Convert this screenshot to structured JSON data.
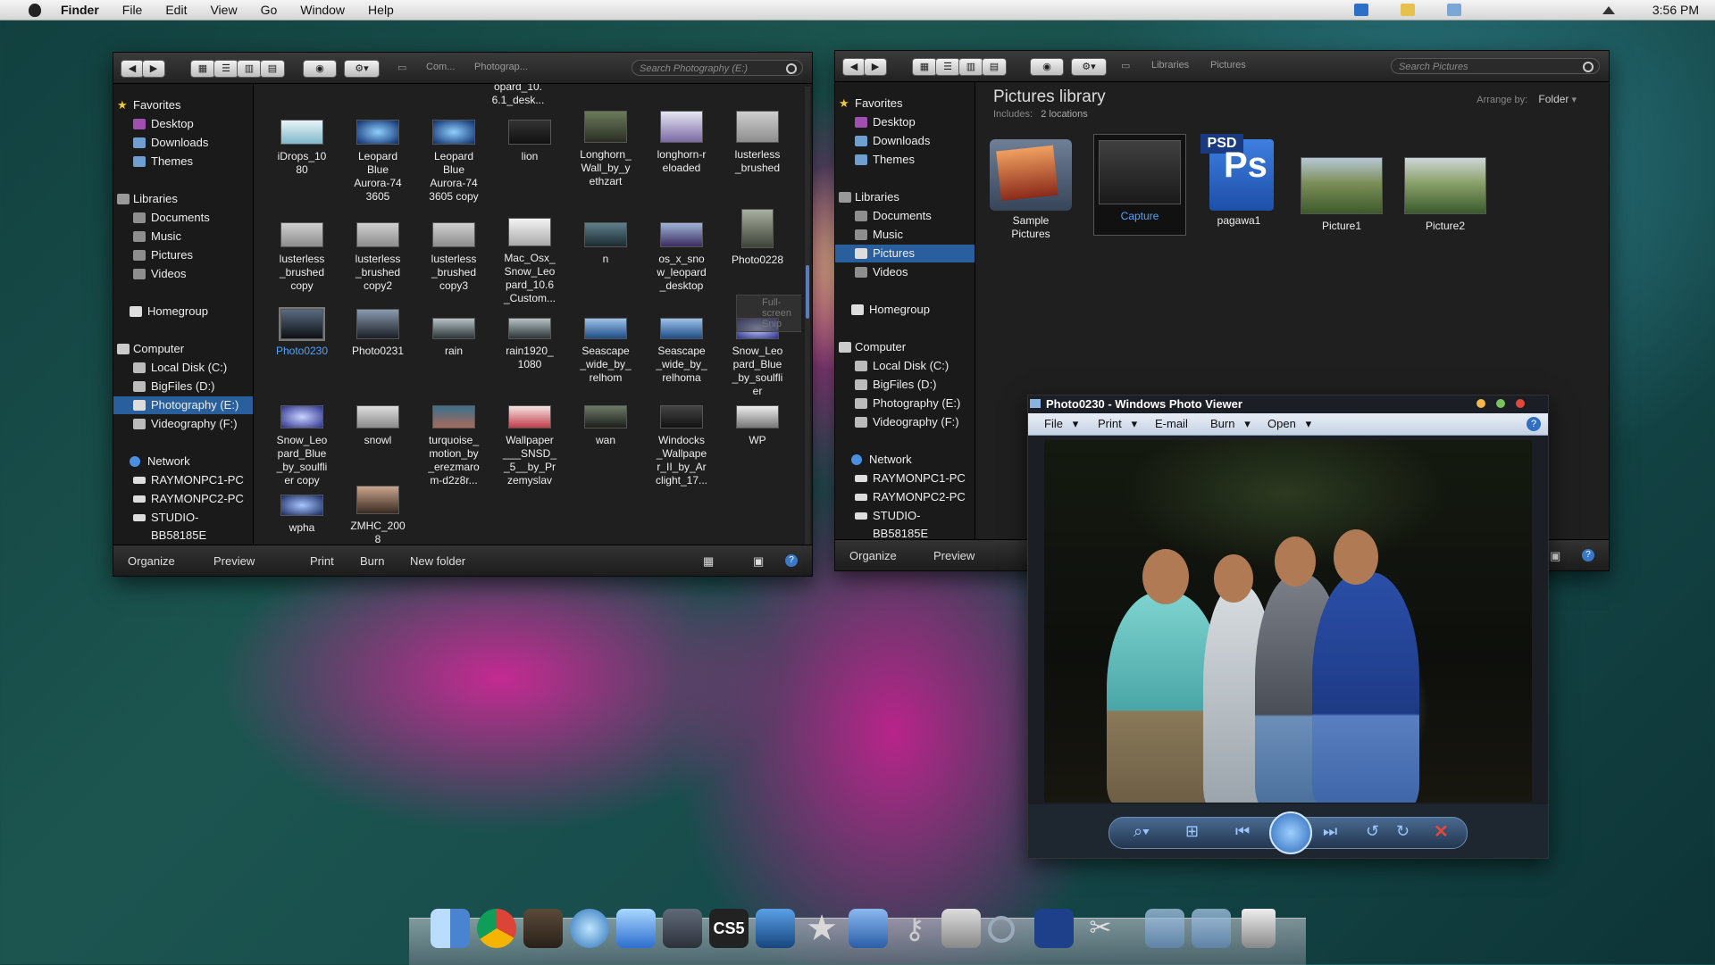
{
  "menubar": {
    "app": "Finder",
    "items": [
      "File",
      "Edit",
      "View",
      "Go",
      "Window",
      "Help"
    ],
    "clock": "3:56 PM"
  },
  "finder1": {
    "breadcrumb": [
      "Com...",
      "Photograp..."
    ],
    "search_placeholder": "Search Photography (E:)",
    "sidebar": {
      "favorites": "Favorites",
      "fav_items": [
        "Desktop",
        "Downloads",
        "Themes"
      ],
      "libraries": "Libraries",
      "lib_items": [
        "Documents",
        "Music",
        "Pictures",
        "Videos"
      ],
      "homegroup": "Homegroup",
      "computer": "Computer",
      "comp_items": [
        "Local Disk (C:)",
        "BigFiles (D:)",
        "Photography (E:)",
        "Videography (F:)"
      ],
      "network": "Network",
      "net_items": [
        "RAYMONPC1-PC",
        "RAYMONPC2-PC",
        "STUDIO-BB58185E"
      ]
    },
    "files": [
      "opard_10.\n6.1_desk...",
      "iDrops_10\n80",
      "Leopard\nBlue\nAurora-74\n3605",
      "Leopard\nBlue\nAurora-74\n3605 copy",
      "lion",
      "Longhorn_\nWall_by_y\nethzart",
      "longhorn-r\neloaded",
      "lusterless\n_brushed",
      "lusterless\n_brushed\ncopy",
      "lusterless\n_brushed\ncopy2",
      "lusterless\n_brushed\ncopy3",
      "Mac_Osx_\nSnow_Leo\npard_10.6\n_Custom...",
      "n",
      "os_x_sno\nw_leopard\n_desktop",
      "Photo0228",
      "Photo0230",
      "Photo0231",
      "rain",
      "rain1920_\n1080",
      "Seascape\n_wide_by_\nrelhom",
      "Seascape\n_wide_by_\nrelhoma",
      "Snow_Leo\npard_Blue\n_by_soulfli\ner",
      "Snow_Leo\npard_Blue\n_by_soulfli\ner copy",
      "snowl",
      "turquoise_\nmotion_by\n_erezmaro\nm-d2z8r...",
      "Wallpaper\n___SNSD_\n_5__by_Pr\nzemyslav",
      "wan",
      "Windocks\n_Wallpape\nr_II_by_Ar\nclight_17...",
      "WP",
      "wpha",
      "ZMHC_200\n8"
    ],
    "tooltip": "Full-screen Snip",
    "bottom": [
      "Organize",
      "Preview",
      "Print",
      "Burn",
      "New folder"
    ]
  },
  "finder2": {
    "breadcrumb": [
      "Libraries",
      "Pictures"
    ],
    "search_placeholder": "Search Pictures",
    "title": "Pictures library",
    "includes_label": "Includes:",
    "includes_value": "2 locations",
    "arrange_label": "Arrange by:",
    "arrange_value": "Folder",
    "items": [
      "Sample\nPictures",
      "Capture",
      "pagawa1",
      "Picture1",
      "Picture2"
    ],
    "psd_badge": "PSD",
    "ps_glyph": "Ps",
    "bottom": [
      "Organize",
      "Preview"
    ]
  },
  "photoviewer": {
    "title": "Photo0230 - Windows Photo Viewer",
    "menu": [
      "File",
      "Print",
      "E-mail",
      "Burn",
      "Open"
    ]
  },
  "dock": {
    "css5_label": "CS5"
  },
  "colors": {
    "selection": "#2a5f9e",
    "link_blue": "#4ba3ff"
  }
}
